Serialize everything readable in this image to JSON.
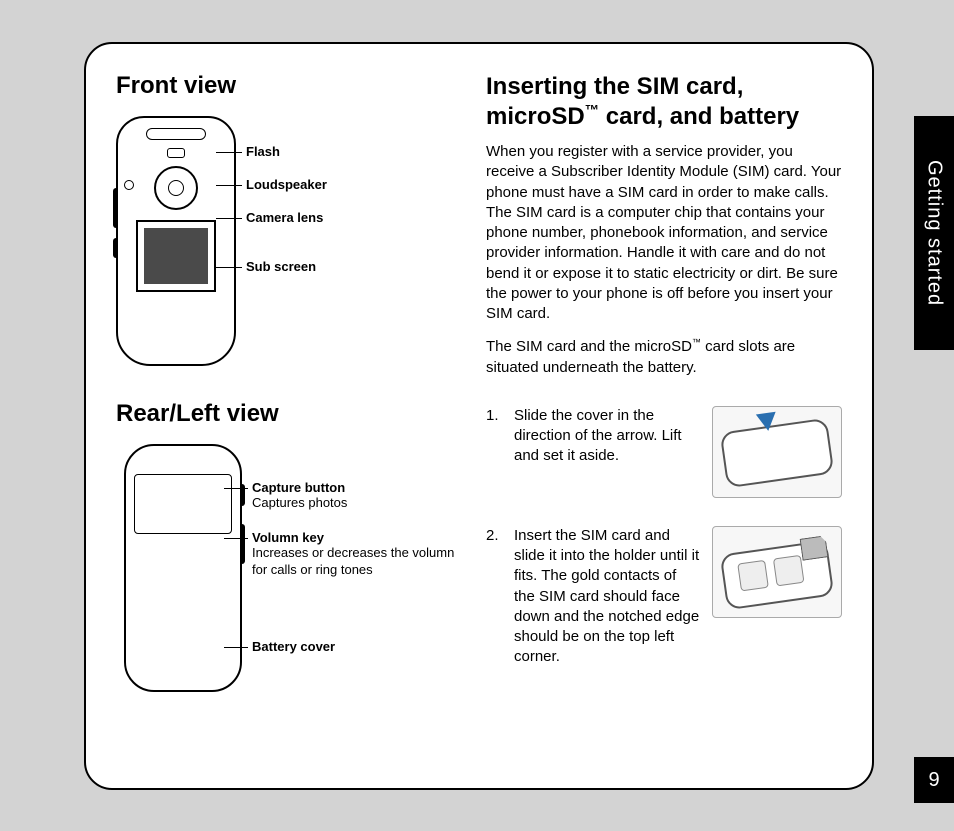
{
  "sideTab": "Getting started",
  "pageNumber": "9",
  "left": {
    "frontHeading": "Front view",
    "frontLabels": {
      "flash": "Flash",
      "loudspeaker": "Loudspeaker",
      "cameraLens": "Camera lens",
      "subScreen": "Sub screen"
    },
    "rearHeading": "Rear/Left view",
    "rearLabels": {
      "captureTitle": "Capture button",
      "captureDesc": "Captures photos",
      "volumeTitle": "Volumn key",
      "volumeDesc": "Increases or decreases the volumn for calls or ring tones",
      "batteryTitle": "Battery cover"
    }
  },
  "right": {
    "headingLine1": "Inserting the SIM card,",
    "headingLine2a": "microSD",
    "headingTM": "™",
    "headingLine2b": " card, and battery",
    "para1": "When you register with a service provider, you receive a Subscriber Identity Module (SIM) card. Your phone must have a SIM card in order to make calls. The SIM card is a computer chip that contains your phone number, phonebook information, and service provider information. Handle it with care and do not bend it or expose it to static electricity or dirt. Be sure the power to your phone is off before you insert your SIM card.",
    "para2a": "The SIM card and the microSD",
    "para2tm": "™",
    "para2b": " card slots are situated underneath the battery.",
    "steps": [
      {
        "num": "1.",
        "text": "Slide the cover in the direction of the arrow. Lift and set it aside."
      },
      {
        "num": "2.",
        "text": "Insert the SIM card and slide it into the holder until it fits. The gold contacts of the SIM card should face down and the notched edge should be on the top left corner."
      }
    ]
  }
}
